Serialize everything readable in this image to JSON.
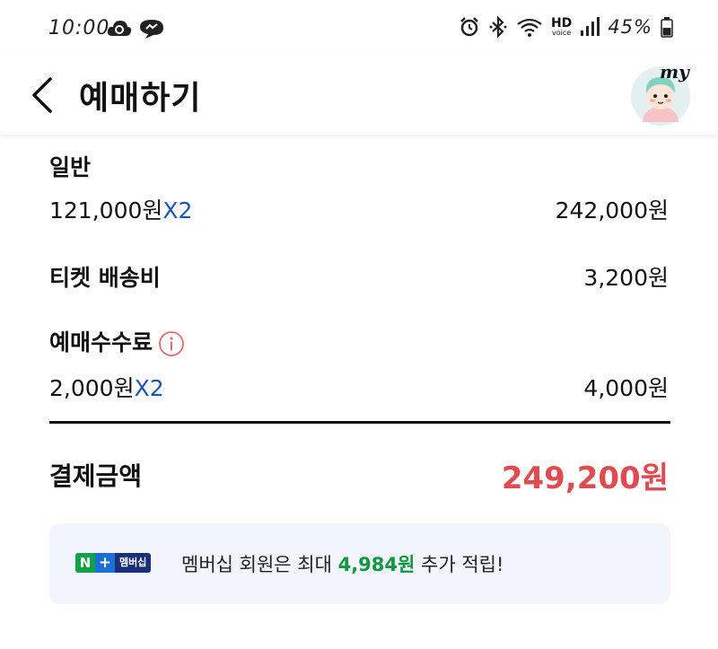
{
  "status_bar": {
    "time": "10:00",
    "battery_percent": "45%",
    "hd_label": "HD",
    "hd_sub": "voice",
    "icons": [
      "cloud-sync-icon",
      "messenger-icon",
      "alarm-icon",
      "bluetooth-icon",
      "wifi-icon",
      "signal-icon",
      "battery-icon"
    ]
  },
  "header": {
    "title": "예매하기",
    "avatar_label": "my"
  },
  "prices": {
    "general": {
      "label": "일반",
      "unit_price": "121,000원",
      "multiplier": "X2",
      "amount": "242,000원"
    },
    "delivery": {
      "label": "티켓 배송비",
      "amount": "3,200원"
    },
    "fee": {
      "label": "예매수수료",
      "unit_price": "2,000원",
      "multiplier": "X2",
      "amount": "4,000원"
    }
  },
  "total": {
    "label": "결제금액",
    "amount": "249,200원"
  },
  "banner": {
    "badge_n": "N",
    "badge_plus": "+",
    "badge_text": "멤버십",
    "text_before": "멤버십 회원은 최대 ",
    "points": "4,984원",
    "text_after": " 추가 적립!"
  },
  "colors": {
    "accent_blue": "#1a56b6",
    "total_red": "#e04b50",
    "points_green": "#10973f",
    "banner_bg": "#f2f5fb"
  }
}
